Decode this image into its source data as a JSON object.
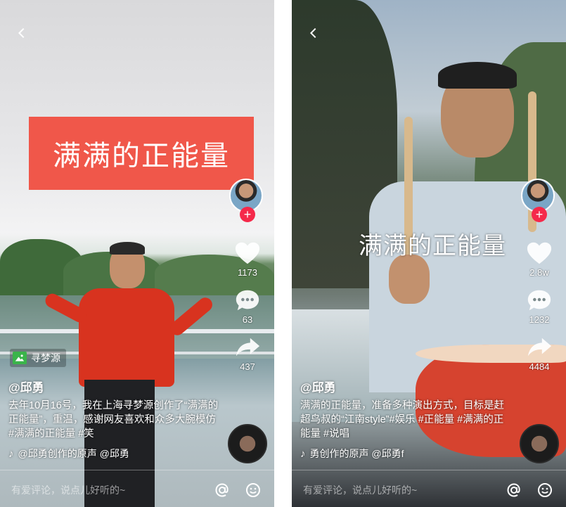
{
  "screens": [
    {
      "banner_text": "满满的正能量",
      "source_tag": "寻梦源",
      "username": "@邱勇",
      "description": "去年10月16号，我在上海寻梦源创作了“满满的正能量”，重温，感谢网友喜欢和众多大腕模仿#满满的正能量 #笑",
      "music": "@邱勇创作的原声    @邱勇",
      "like_count": "1173",
      "comment_count": "63",
      "share_count": "437",
      "comment_placeholder": "有爱评论，说点儿好听的~"
    },
    {
      "overlay_text": "满满的正能量",
      "username": "@邱勇",
      "description": "满满的正能量，准备多种演出方式，目标是赶超鸟叔的“江南style”#娱乐 #正能量 #满满的正能量 #说唱",
      "music": "勇创作的原声    @邱勇f",
      "like_count": "2.8w",
      "comment_count": "1232",
      "share_count": "4484",
      "comment_placeholder": "有爱评论，说点儿好听的~"
    }
  ],
  "icons": {
    "back": "chevron-left-icon",
    "like": "heart-icon",
    "comment": "speech-bubble-icon",
    "share": "share-arrow-icon",
    "mention": "at-icon",
    "emoji": "smiley-icon",
    "music": "music-note-icon",
    "follow": "plus-icon"
  },
  "colors": {
    "banner": "#f0574a",
    "follow_button": "#f5294a",
    "source_icon": "#3ab44a"
  }
}
